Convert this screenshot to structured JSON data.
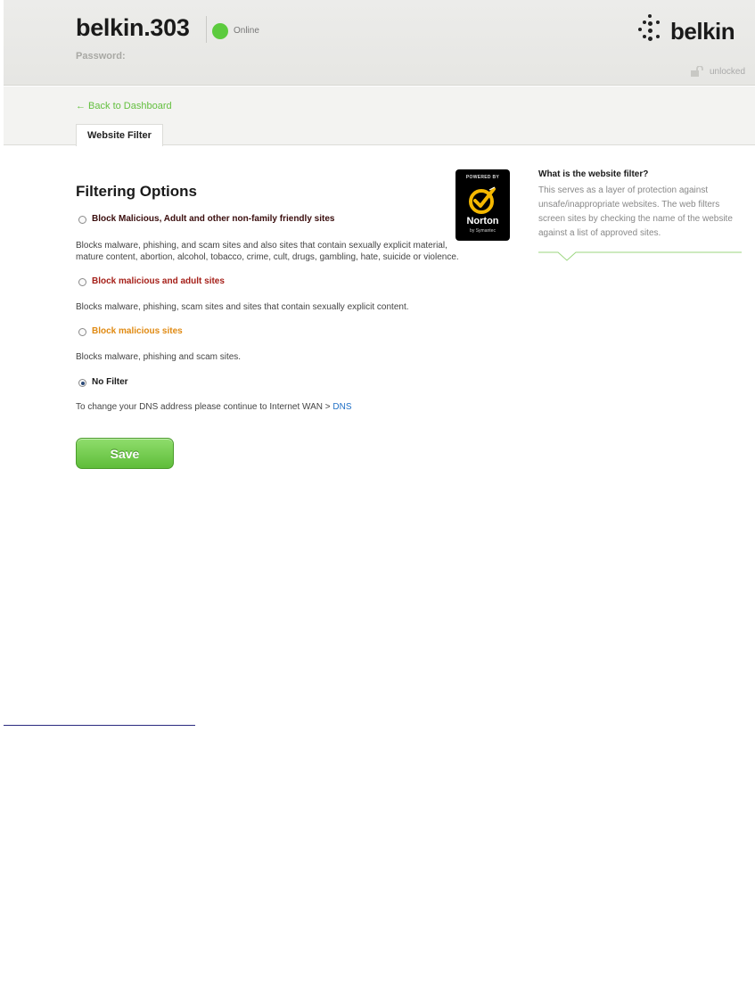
{
  "header": {
    "device_name": "belkin.303",
    "status": "Online",
    "password_label": "Password:",
    "brand": "belkin",
    "lock_status": "unlocked"
  },
  "nav": {
    "back_link": "← Back to Dashboard",
    "tab": "Website Filter"
  },
  "main": {
    "title": "Filtering Options",
    "options": [
      {
        "label": "Block Malicious, Adult and other non-family friendly sites",
        "description": "Blocks malware, phishing, and scam sites and also sites that contain sexually explicit material, mature content, abortion, alcohol, tobacco, crime, cult, drugs, gambling, hate, suicide or violence.",
        "selected": false,
        "color": "#3a0d0d"
      },
      {
        "label": "Block malicious and adult sites",
        "description": "Blocks malware, phishing, scam sites and sites that contain sexually explicit content.",
        "selected": false,
        "color": "#a52019"
      },
      {
        "label": "Block malicious sites",
        "description": "Blocks malware, phishing and scam sites.",
        "selected": false,
        "color": "#e08a12"
      },
      {
        "label": "No Filter",
        "description": "To change your DNS address please continue to Internet WAN > ",
        "selected": true,
        "color": "#1a1a1a"
      }
    ],
    "dns_link": "DNS",
    "save_label": "Save"
  },
  "norton_badge": {
    "powered_by": "POWERED BY",
    "name": "Norton",
    "by": "by Symantec"
  },
  "sidebar": {
    "title": "What is the website filter?",
    "text": "This serves as a layer of protection against unsafe/inappropriate websites. The web filters screen sites by checking the name of the website against a list of approved sites."
  },
  "colors": {
    "accent_green": "#63bf3f",
    "status_green": "#5ccb3e",
    "link_blue": "#1f6fc6"
  }
}
